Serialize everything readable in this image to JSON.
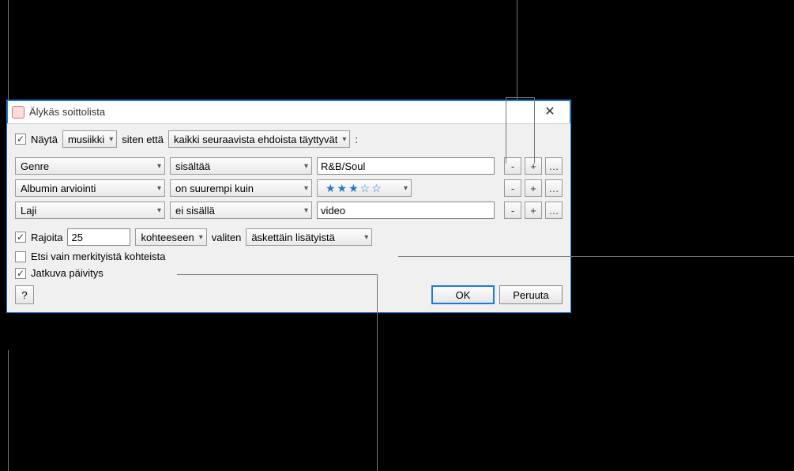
{
  "title": "Älykäs soittolista",
  "top_row": {
    "show_label": "Näytä",
    "media_type": "musiikki",
    "when_label": "siten että",
    "match_rule": "kaikki seuraavista ehdoista täyttyvät",
    "colon": ":"
  },
  "rules": [
    {
      "field": "Genre",
      "op": "sisältää",
      "value": "R&B/Soul",
      "type": "text"
    },
    {
      "field": "Albumin arviointi",
      "op": "on suurempi kuin",
      "value": "★★★☆☆",
      "type": "stars"
    },
    {
      "field": "Laji",
      "op": "ei sisällä",
      "value": "video",
      "type": "text"
    }
  ],
  "limit": {
    "label": "Rajoita",
    "count": "25",
    "unit": "kohteeseen",
    "selected_by_label": "valiten",
    "selected_by": "äskettäin lisätyistä"
  },
  "search_checked_only": "Etsi vain merkityistä kohteista",
  "live_updating": "Jatkuva päivitys",
  "buttons": {
    "help": "?",
    "ok": "OK",
    "cancel": "Peruuta",
    "minus": "-",
    "plus": "+",
    "more": "…"
  }
}
